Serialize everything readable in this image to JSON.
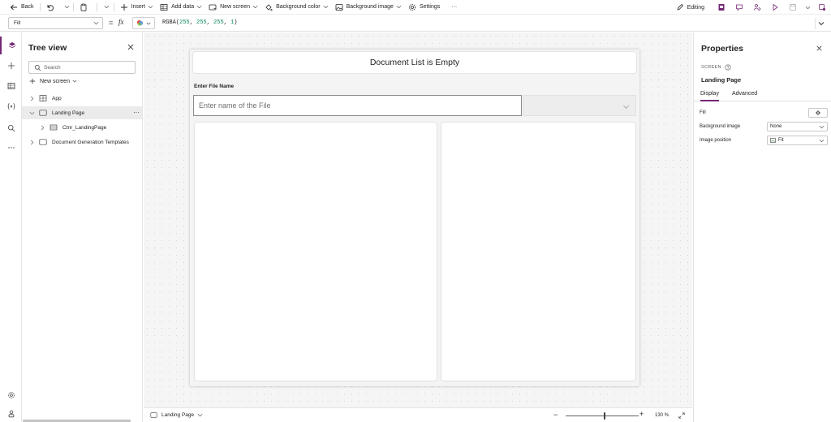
{
  "toolbar": {
    "back": "Back",
    "insert": "Insert",
    "add_data": "Add data",
    "new_screen": "New screen",
    "background_color": "Background color",
    "background_image": "Background image",
    "settings": "Settings",
    "more": "···",
    "editing": "Editing"
  },
  "formula_bar": {
    "property": "Fill",
    "equals": "=",
    "fx": "fx",
    "formula_fn": "RGBA(",
    "formula_args": [
      "255",
      "255",
      "255",
      "1"
    ],
    "formula_close": ")"
  },
  "tree": {
    "title": "Tree view",
    "search_placeholder": "Search",
    "new_screen": "New screen",
    "nodes": [
      {
        "label": "App"
      },
      {
        "label": "Landing Page"
      },
      {
        "label": "Ctnr_LandingPage"
      },
      {
        "label": "Document Generation Templates"
      }
    ],
    "more": "···"
  },
  "canvas": {
    "header_title": "Document List is Empty",
    "input_label": "Enter File Name",
    "input_placeholder": "Enter name of the File"
  },
  "status": {
    "screen": "Landing Page",
    "zoom_minus": "−",
    "zoom_plus": "+",
    "zoom": "130 %"
  },
  "properties": {
    "title": "Properties",
    "kind": "SCREEN",
    "name": "Landing Page",
    "tabs": [
      "Display",
      "Advanced"
    ],
    "fill_label": "Fill",
    "bg_image_label": "Background image",
    "bg_image_value": "None",
    "image_position_label": "Image position",
    "image_position_value": "Fit"
  },
  "colors": {
    "accent": "#742774",
    "canvas_bg": "#f5f5f5"
  }
}
